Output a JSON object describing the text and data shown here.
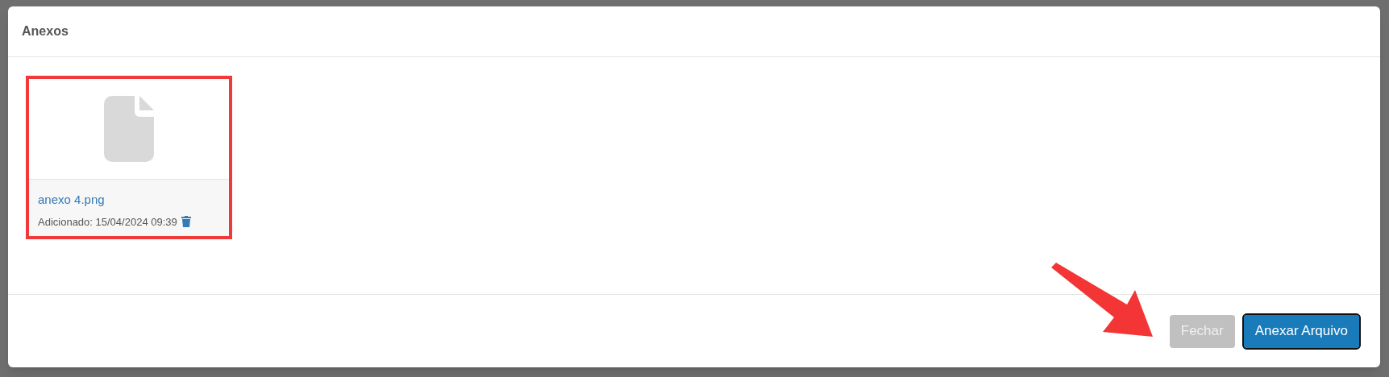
{
  "dialog": {
    "title": "Anexos"
  },
  "attachments": [
    {
      "name": "anexo 4.png",
      "added": "Adicionado: 15/04/2024 09:39",
      "highlighted": true
    }
  ],
  "buttons": [
    {
      "label": "Fechar",
      "kind": "secondary",
      "disabled": true,
      "focused": false
    },
    {
      "label": "Anexar Arquivo",
      "kind": "primary",
      "disabled": false,
      "focused": true
    }
  ],
  "annotation_arrow": true
}
